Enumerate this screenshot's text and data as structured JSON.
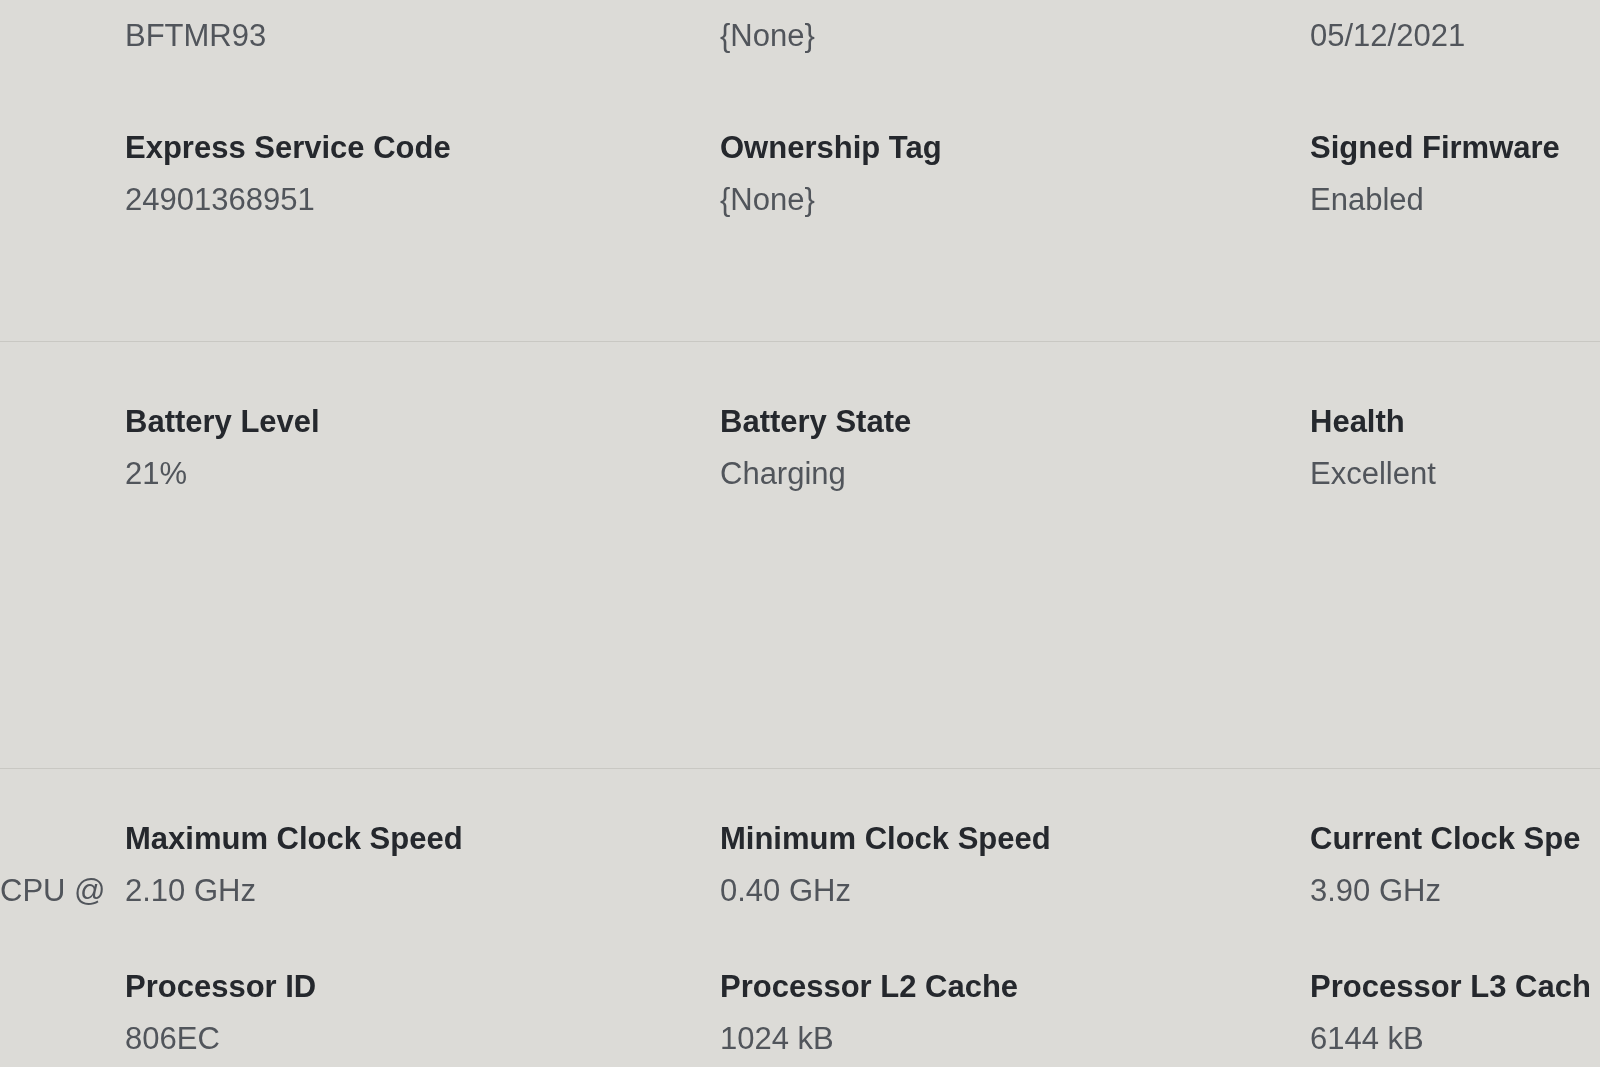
{
  "sections": [
    {
      "rows": [
        {
          "fields": [
            {
              "value": "BFTMR93"
            },
            {
              "value": "{None}"
            },
            {
              "value": "05/12/2021"
            }
          ]
        },
        {
          "fields": [
            {
              "label": "Express Service Code",
              "value": "24901368951"
            },
            {
              "label": "Ownership Tag",
              "value": "{None}"
            },
            {
              "label": "Signed Firmware",
              "value": "Enabled"
            }
          ]
        }
      ]
    },
    {
      "rows": [
        {
          "fields": [
            {
              "label": "Battery Level",
              "value": "21%"
            },
            {
              "label": "Battery State",
              "value": "Charging"
            },
            {
              "label": "Health",
              "value": "Excellent"
            }
          ]
        }
      ]
    },
    {
      "rows": [
        {
          "cut_value": "CPU @",
          "fields": [
            {
              "label": "Maximum Clock Speed",
              "value": "2.10 GHz"
            },
            {
              "label": "Minimum Clock Speed",
              "value": "0.40 GHz"
            },
            {
              "label": "Current Clock Spe",
              "value": "3.90 GHz"
            }
          ]
        },
        {
          "fields": [
            {
              "label": "Processor ID",
              "value": "806EC"
            },
            {
              "label": "Processor L2 Cache",
              "value": "1024 kB"
            },
            {
              "label": "Processor L3 Cach",
              "value": "6144 kB"
            }
          ]
        }
      ]
    }
  ]
}
